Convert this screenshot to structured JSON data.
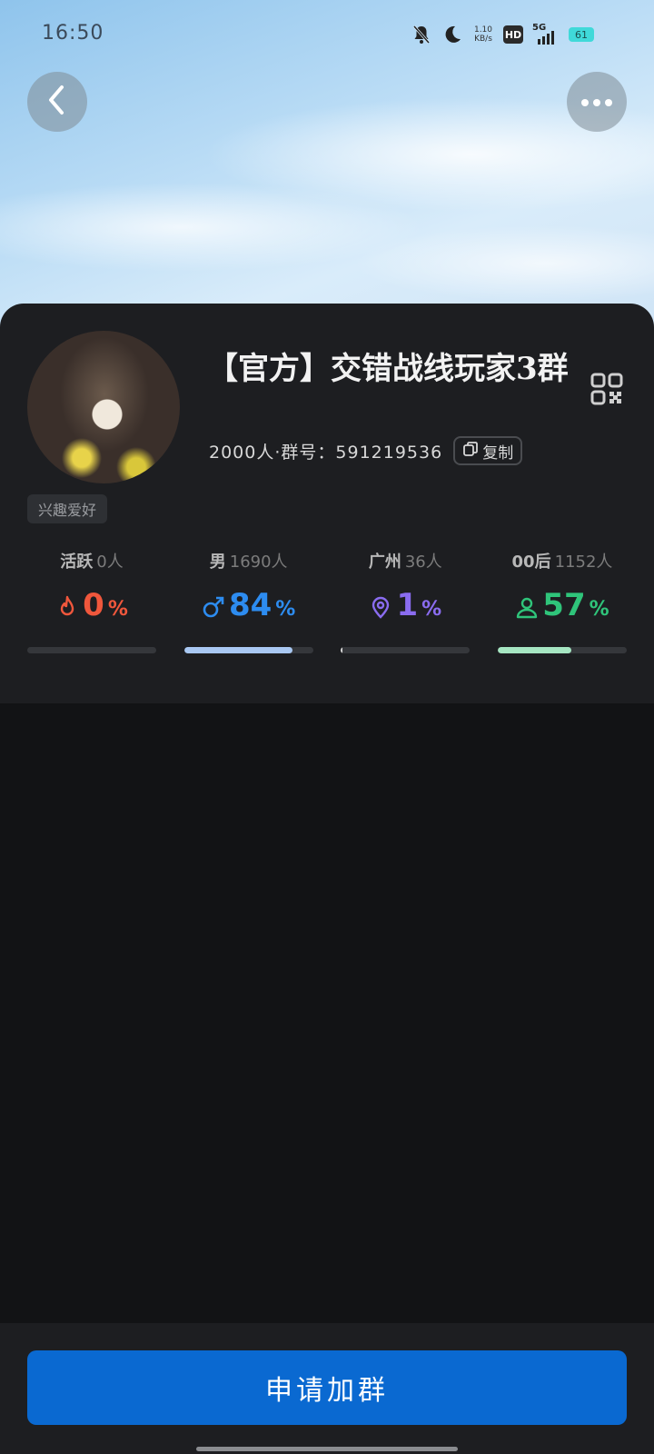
{
  "status_bar": {
    "time": "16:50",
    "net_speed_value": "1.10",
    "net_speed_unit": "KB/s",
    "hd_label": "HD",
    "network_label": "5G",
    "battery": "61"
  },
  "group": {
    "title": "【官方】交错战线玩家3群",
    "member_count": "2000人",
    "group_number_label": "·群号：591219536",
    "copy_label": "复制",
    "tag": "兴趣爱好"
  },
  "stats": [
    {
      "label": "活跃",
      "count": "0人",
      "value": "0",
      "unit": "%",
      "fraction": 0.0,
      "color": "#f0573c",
      "icon": "flame-icon",
      "bar_color": "#f0573c"
    },
    {
      "label": "男",
      "count": "1690人",
      "value": "84",
      "unit": "%",
      "fraction": 0.84,
      "color": "#2d8cf0",
      "icon": "male-icon",
      "bar_color": "#a9c8f2"
    },
    {
      "label": "广州",
      "count": "36人",
      "value": "1",
      "unit": "%",
      "fraction": 0.01,
      "color": "#8a6cf0",
      "icon": "location-pin-icon",
      "bar_color": "#d8d8d8"
    },
    {
      "label": "00后",
      "count": "1152人",
      "value": "57",
      "unit": "%",
      "fraction": 0.57,
      "color": "#2fc47a",
      "icon": "person-icon",
      "bar_color": "#a6e6c2"
    }
  ],
  "actions": {
    "join_label": "申请加群"
  },
  "icons": {
    "back": "back-arrow-icon",
    "more": "more-dots-icon",
    "qr": "qr-code-icon",
    "copy": "copy-icon"
  }
}
